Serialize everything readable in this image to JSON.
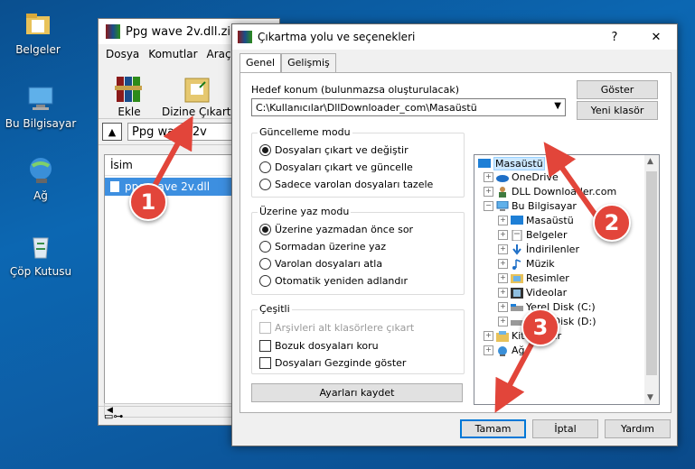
{
  "desktop": {
    "icons": [
      {
        "label": "Belgeler",
        "icon": "folder-documents-icon"
      },
      {
        "label": "Bu Bilgisayar",
        "icon": "computer-icon"
      },
      {
        "label": "Ağ",
        "icon": "network-icon"
      },
      {
        "label": "Çöp Kutusu",
        "icon": "recycle-bin-icon"
      }
    ]
  },
  "rar_window": {
    "title": "Ppg wave 2v.dll.zip",
    "menu": [
      "Dosya",
      "Komutlar",
      "Araçla"
    ],
    "tools": [
      "Ekle",
      "Dizine Çıkart"
    ],
    "address": "Ppg wave 2v",
    "column": "İsim",
    "file": "ppg wave 2v.dll"
  },
  "dialog": {
    "title": "Çıkartma yolu ve seçenekleri",
    "help": "?",
    "close": "✕",
    "tabs": [
      "Genel",
      "Gelişmiş"
    ],
    "dest_label": "Hedef konum (bulunmazsa oluşturulacak)",
    "dest_value": "C:\\Kullanıcılar\\DllDownloader_com\\Masaüstü",
    "show_button": "Göster",
    "new_folder_button": "Yeni klasör",
    "update_group": {
      "title": "Güncelleme modu",
      "options": [
        "Dosyaları çıkart ve değiştir",
        "Dosyaları çıkart ve güncelle",
        "Sadece varolan dosyaları tazele"
      ],
      "selected": 0
    },
    "overwrite_group": {
      "title": "Üzerine yaz modu",
      "options": [
        "Üzerine yazmadan önce sor",
        "Sormadan üzerine yaz",
        "Varolan dosyaları atla",
        "Otomatik yeniden adlandır"
      ],
      "selected": 0
    },
    "misc_group": {
      "title": "Çeşitli",
      "options": [
        "Arşivleri alt klasörlere çıkart",
        "Bozuk dosyaları koru",
        "Dosyaları Gezginde göster"
      ]
    },
    "save_settings": "Ayarları kaydet",
    "tree": [
      {
        "label": "Masaüstü",
        "icon": "desktop-icon",
        "selected": true
      },
      {
        "label": "OneDrive",
        "icon": "cloud-icon"
      },
      {
        "label": "DLL Downloader.com",
        "icon": "user-icon"
      },
      {
        "label": "Bu Bilgisayar",
        "icon": "computer-icon"
      },
      {
        "label": "Masaüstü",
        "icon": "desktop-icon"
      },
      {
        "label": "Belgeler",
        "icon": "documents-icon"
      },
      {
        "label": "İndirilenler",
        "icon": "download-icon"
      },
      {
        "label": "Müzik",
        "icon": "music-icon"
      },
      {
        "label": "Resimler",
        "icon": "pictures-icon"
      },
      {
        "label": "Videolar",
        "icon": "video-icon"
      },
      {
        "label": "Yerel Disk (C:)",
        "icon": "drive-icon"
      },
      {
        "label": "Yerel Disk (D:)",
        "icon": "drive-icon"
      },
      {
        "label": "Kitaplıklar",
        "icon": "library-icon"
      },
      {
        "label": "Ağ",
        "icon": "network-icon"
      }
    ],
    "ok": "Tamam",
    "cancel": "İptal",
    "help_button": "Yardım"
  },
  "annotations": [
    "1",
    "2",
    "3"
  ],
  "colors": {
    "badge": "#e2453a",
    "selection": "#3d8fe0",
    "default_button": "#0078d7"
  }
}
